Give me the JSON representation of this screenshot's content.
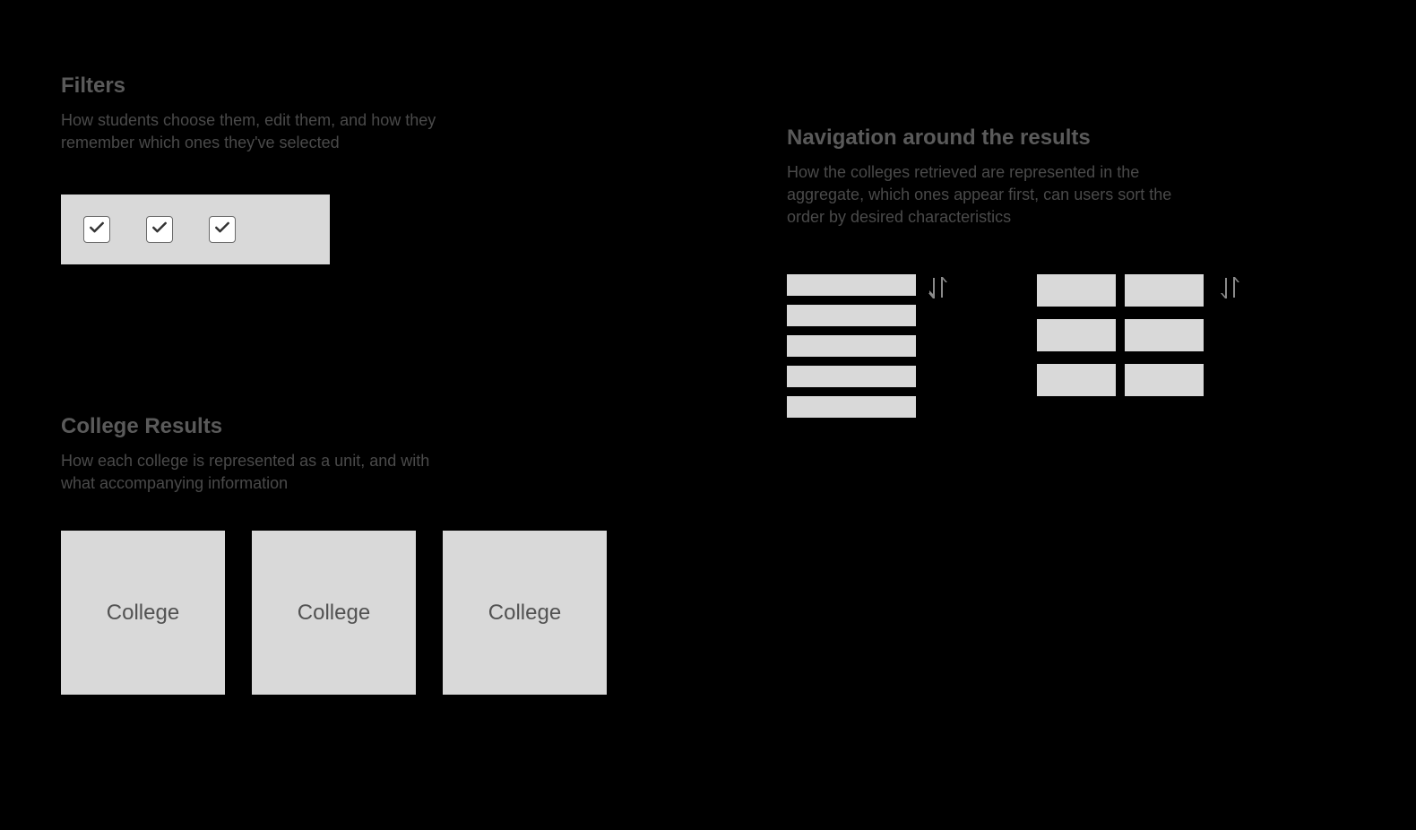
{
  "filters": {
    "title": "Filters",
    "description": "How students choose them, edit them, and how they remember which ones they've selected"
  },
  "collegeResults": {
    "title": "College Results",
    "description": "How each college is represented as a unit, and with what accompanying information",
    "cards": [
      "College",
      "College",
      "College"
    ]
  },
  "navigation": {
    "title": "Navigation around the results",
    "description": "How the colleges retrieved are represented in the aggregate, which ones appear first, can users sort the order by desired characteristics"
  }
}
